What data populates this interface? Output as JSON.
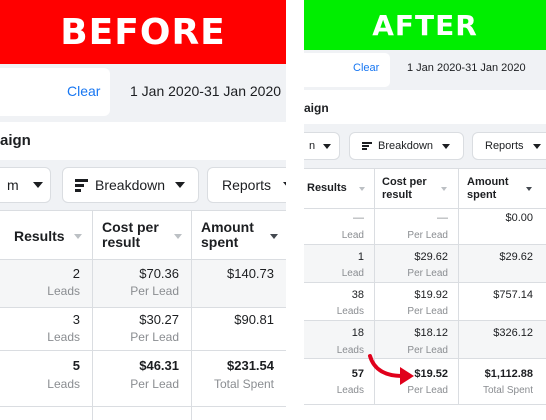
{
  "before": {
    "banner": "BEFORE",
    "banner_color": "#ff0000",
    "toolbar": {
      "clear": "Clear",
      "date_range": "1 Jan 2020-31 Jan 2020"
    },
    "title_fragment": "aign",
    "controls": {
      "view_fragment": "m",
      "breakdown": "Breakdown",
      "reports": "Reports"
    },
    "headers": {
      "results": "Results",
      "cost_per_result": [
        "Cost per",
        "result"
      ],
      "amount_spent": [
        "Amount",
        "spent"
      ]
    },
    "rows": [
      {
        "results": "2",
        "results_sub": "Leads",
        "cost": "$70.36",
        "cost_sub": "Per Lead",
        "amount": "$140.73",
        "amount_sub": ""
      },
      {
        "results": "3",
        "results_sub": "Leads",
        "cost": "$30.27",
        "cost_sub": "Per Lead",
        "amount": "$90.81",
        "amount_sub": ""
      }
    ],
    "total": {
      "results": "5",
      "results_sub": "Leads",
      "cost": "$46.31",
      "cost_sub": "Per Lead",
      "amount": "$231.54",
      "amount_sub": "Total Spent"
    }
  },
  "after": {
    "banner": "AFTER",
    "banner_color": "#00ee00",
    "toolbar": {
      "clear": "Clear",
      "date_range": "1 Jan 2020-31 Jan 2020"
    },
    "title_fragment": "aign",
    "controls": {
      "view_fragment": "n",
      "breakdown": "Breakdown",
      "reports": "Reports"
    },
    "headers": {
      "results": "Results",
      "cost_per_result": [
        "Cost per",
        "result"
      ],
      "amount_spent": [
        "Amount",
        "spent"
      ]
    },
    "rows": [
      {
        "results": "—",
        "results_sub": "Lead",
        "cost": "—",
        "cost_sub": "Per Lead",
        "amount": "$0.00",
        "amount_sub": ""
      },
      {
        "results": "1",
        "results_sub": "Lead",
        "cost": "$29.62",
        "cost_sub": "Per Lead",
        "amount": "$29.62",
        "amount_sub": ""
      },
      {
        "results": "38",
        "results_sub": "Leads",
        "cost": "$19.92",
        "cost_sub": "Per Lead",
        "amount": "$757.14",
        "amount_sub": ""
      },
      {
        "results": "18",
        "results_sub": "Leads",
        "cost": "$18.12",
        "cost_sub": "Per Lead",
        "amount": "$326.12",
        "amount_sub": ""
      }
    ],
    "total": {
      "results": "57",
      "results_sub": "Leads",
      "cost": "$19.52",
      "cost_sub": "Per Lead",
      "amount": "$1,112.88",
      "amount_sub": "Total Spent"
    },
    "arrow_color": "#e0001b"
  }
}
